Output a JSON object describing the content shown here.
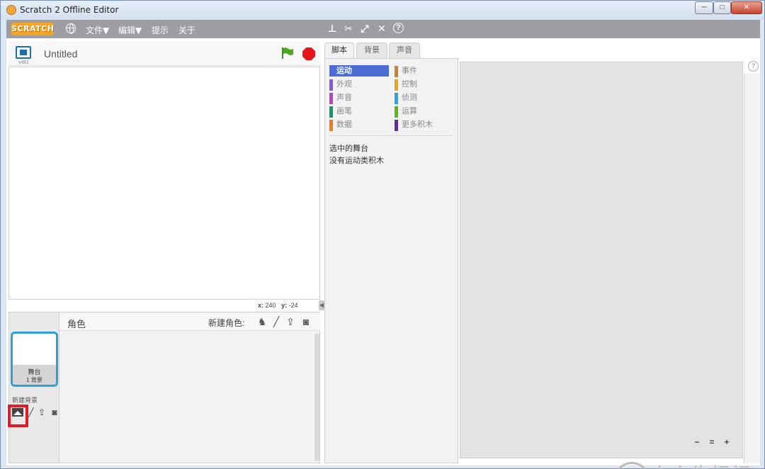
{
  "window": {
    "title": "Scratch 2 Offline Editor",
    "minimize": "─",
    "maximize": "□",
    "close": "✕"
  },
  "menubar": {
    "logo": "SCRATCH",
    "items": [
      "文件▼",
      "编辑▼",
      "提示",
      "关于"
    ],
    "tools": [
      "duplicate-stamp-icon",
      "delete-scissors-icon",
      "grow-icon",
      "shrink-icon",
      "help-icon"
    ]
  },
  "stage": {
    "version": "v461",
    "project_title": "Untitled",
    "coords": {
      "x_label": "x:",
      "x_value": "240",
      "y_label": "y:",
      "y_value": "-24"
    }
  },
  "sprites": {
    "title": "角色",
    "new_sprite_label": "新建角色:",
    "stage_thumb": {
      "name": "舞台",
      "backdrops": "1 背景"
    },
    "new_backdrop_label": "新建背景"
  },
  "tabs": [
    "脚本",
    "背景",
    "声音"
  ],
  "palette": {
    "categories_left": [
      {
        "label": "运动",
        "color": "#4a6cd4"
      },
      {
        "label": "外观",
        "color": "#8a55d7"
      },
      {
        "label": "声音",
        "color": "#bb42c3"
      },
      {
        "label": "画笔",
        "color": "#0e9a6c"
      },
      {
        "label": "数据",
        "color": "#ee7d16"
      }
    ],
    "categories_right": [
      {
        "label": "事件",
        "color": "#c88330"
      },
      {
        "label": "控制",
        "color": "#e1a91a"
      },
      {
        "label": "侦测",
        "color": "#2ca5e2"
      },
      {
        "label": "运算",
        "color": "#5cb712"
      },
      {
        "label": "更多积木",
        "color": "#632d99"
      }
    ],
    "note_line1": "选中的舞台",
    "note_line2": "没有运动类积木"
  },
  "scripts": {
    "help": "?",
    "zoom_out": "−",
    "zoom_reset": "=",
    "zoom_in": "+"
  },
  "watermark": "小小牛妈妈"
}
